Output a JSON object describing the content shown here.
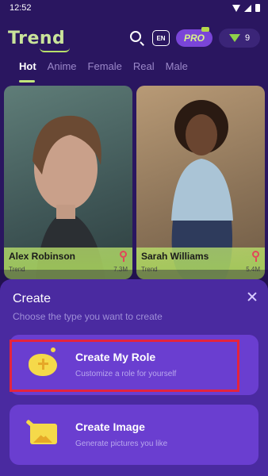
{
  "status": {
    "time": "12:52"
  },
  "header": {
    "logo": "Trend",
    "lang": "EN",
    "pro": "PRO",
    "gems": "9"
  },
  "tabs": [
    "Hot",
    "Anime",
    "Female",
    "Real",
    "Male"
  ],
  "cards": [
    {
      "name": "Alex Robinson",
      "creator": "Trend",
      "likes": "7.3M"
    },
    {
      "name": "Sarah Williams",
      "creator": "Trend",
      "likes": "5.4M"
    }
  ],
  "sheet": {
    "title": "Create",
    "subtitle": "Choose the type you want to create",
    "options": [
      {
        "title": "Create My Role",
        "subtitle": "Customize a role for yourself"
      },
      {
        "title": "Create Image",
        "subtitle": "Generate pictures you like"
      }
    ]
  }
}
